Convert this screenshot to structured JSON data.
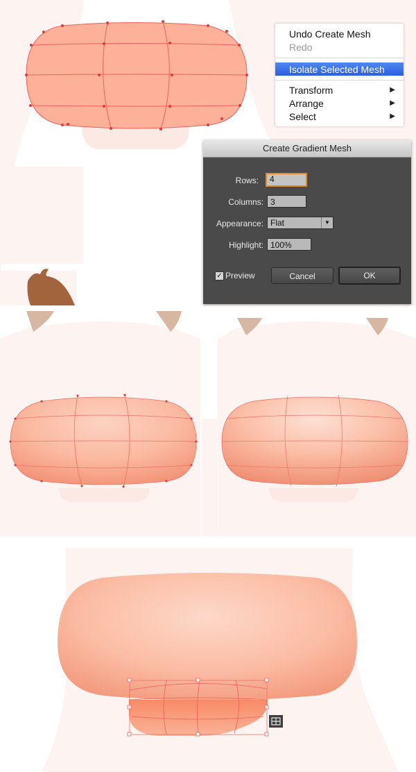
{
  "context_menu": {
    "items": [
      {
        "label": "Undo Create Mesh",
        "enabled": true
      },
      {
        "label": "Redo",
        "enabled": false
      },
      {
        "label": "Isolate Selected Mesh",
        "selected": true
      },
      {
        "label": "Transform",
        "submenu": true
      },
      {
        "label": "Arrange",
        "submenu": true
      },
      {
        "label": "Select",
        "submenu": true
      }
    ],
    "submenu_arrow": "▶"
  },
  "dialog": {
    "title": "Create Gradient Mesh",
    "rows": {
      "label": "Rows:",
      "value": "4"
    },
    "columns": {
      "label": "Columns:",
      "value": "3"
    },
    "appearance": {
      "label": "Appearance:",
      "value": "Flat"
    },
    "highlight": {
      "label": "Highlight:",
      "value": "100%"
    },
    "preview": {
      "label": "Preview",
      "checked": true
    },
    "cancel_label": "Cancel",
    "ok_label": "OK"
  },
  "icons": {
    "dropdown": "chevron-down-icon",
    "checkmark": "✓",
    "mesh_tool": "mesh-tool-icon"
  },
  "colors": {
    "nose_fill": "#fdb199",
    "mesh_line": "#f0605a",
    "mesh_point": "#e53a3a",
    "background_shape": "#fdf3f0",
    "ear": "#d7b7a2",
    "menu_highlight": "#2f66e4",
    "dialog_bg": "#4a4a4a",
    "focus_ring": "#e08a2a"
  }
}
